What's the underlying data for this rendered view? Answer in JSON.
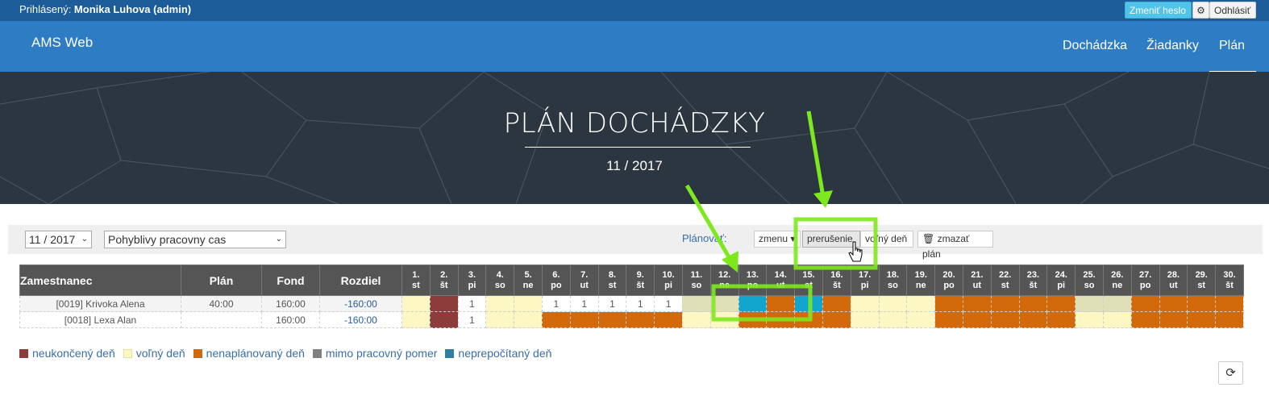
{
  "topbar": {
    "logged_prefix": "Prihlásený: ",
    "logged_user": "Monika Luhova (admin)",
    "change_password": "Zmeniť heslo",
    "logout": "Odhlásiť"
  },
  "navbar": {
    "brand": "AMS Web",
    "items": [
      "Dochádzka",
      "Žiadanky",
      "Plán"
    ],
    "active": "Plán"
  },
  "hero": {
    "title": "PLÁN DOCHÁDZKY",
    "subtitle": "11 / 2017"
  },
  "toolbar": {
    "month_value": "11 / 2017",
    "schedule_value": "Pohyblivy pracovny cas",
    "plan_label": "Plánovať:",
    "btn_shift": "zmenu",
    "btn_break": "prerušenie",
    "btn_free": "voľný deň",
    "btn_delete": "zmazať plán"
  },
  "table": {
    "headers": {
      "employee": "Zamestnanec",
      "plan": "Plán",
      "fund": "Fond",
      "diff": "Rozdiel"
    },
    "days": [
      {
        "n": "1.",
        "w": "st"
      },
      {
        "n": "2.",
        "w": "št"
      },
      {
        "n": "3.",
        "w": "pi"
      },
      {
        "n": "4.",
        "w": "so"
      },
      {
        "n": "5.",
        "w": "ne"
      },
      {
        "n": "6.",
        "w": "po"
      },
      {
        "n": "7.",
        "w": "ut"
      },
      {
        "n": "8.",
        "w": "st"
      },
      {
        "n": "9.",
        "w": "št"
      },
      {
        "n": "10.",
        "w": "pi"
      },
      {
        "n": "11.",
        "w": "so"
      },
      {
        "n": "12.",
        "w": "ne"
      },
      {
        "n": "13.",
        "w": "po"
      },
      {
        "n": "14.",
        "w": "ut"
      },
      {
        "n": "15.",
        "w": "st"
      },
      {
        "n": "16.",
        "w": "št"
      },
      {
        "n": "17.",
        "w": "pi"
      },
      {
        "n": "18.",
        "w": "so"
      },
      {
        "n": "19.",
        "w": "ne"
      },
      {
        "n": "20.",
        "w": "po"
      },
      {
        "n": "21.",
        "w": "ut"
      },
      {
        "n": "22.",
        "w": "st"
      },
      {
        "n": "23.",
        "w": "št"
      },
      {
        "n": "24.",
        "w": "pi"
      },
      {
        "n": "25.",
        "w": "so"
      },
      {
        "n": "26.",
        "w": "ne"
      },
      {
        "n": "27.",
        "w": "po"
      },
      {
        "n": "28.",
        "w": "ut"
      },
      {
        "n": "29.",
        "w": "st"
      },
      {
        "n": "30.",
        "w": "št"
      }
    ],
    "rows": [
      {
        "name": "[0019] Krivoka Alena",
        "plan": "40:00",
        "fund": "160:00",
        "diff": "-160:00",
        "cells": [
          "y",
          "r",
          "w",
          "y",
          "y",
          "w",
          "w",
          "w",
          "w",
          "w",
          "g",
          "g",
          "c",
          "o",
          "c",
          "o",
          "y",
          "y",
          "y",
          "o",
          "o",
          "o",
          "o",
          "o",
          "g",
          "g",
          "o",
          "o",
          "o",
          "o"
        ],
        "values": [
          "",
          "",
          "1",
          "",
          "",
          "1",
          "1",
          "1",
          "1",
          "1",
          "",
          "",
          "",
          "",
          "",
          "",
          "",
          "",
          "",
          "",
          "",
          "",
          "",
          "",
          "",
          "",
          "",
          "",
          "",
          ""
        ]
      },
      {
        "name": "[0018] Lexa Alan",
        "plan": "",
        "fund": "160:00",
        "diff": "-160:00",
        "cells": [
          "y",
          "r",
          "w",
          "y",
          "y",
          "o",
          "o",
          "o",
          "o",
          "o",
          "y",
          "y",
          "o",
          "o",
          "o",
          "o",
          "y",
          "y",
          "y",
          "o",
          "o",
          "o",
          "o",
          "o",
          "y",
          "y",
          "o",
          "o",
          "o",
          "o"
        ],
        "values": [
          "",
          "",
          "1",
          "",
          "",
          "",
          "",
          "",
          "",
          "",
          "",
          "",
          "",
          "",
          "",
          "",
          "",
          "",
          "",
          "",
          "",
          "",
          "",
          "",
          "",
          "",
          "",
          "",
          "",
          ""
        ]
      }
    ]
  },
  "cell_colors": {
    "y": "#fdf7c3",
    "r": "#8e3b3b",
    "w": "#ffffff",
    "g": "#e0e0b8",
    "o": "#d2690b",
    "c": "#12a6cf"
  },
  "legend": [
    {
      "label": "neukončený deň",
      "color": "#8e3b3b"
    },
    {
      "label": "voľný deň",
      "color": "#fdf7c3"
    },
    {
      "label": "nenaplánovaný deň",
      "color": "#d2690b"
    },
    {
      "label": "mimo pracovný pomer",
      "color": "#808080"
    },
    {
      "label": "neprepočítaný deň",
      "color": "#2e7fa0"
    }
  ],
  "accent_green": "#7ee81f"
}
